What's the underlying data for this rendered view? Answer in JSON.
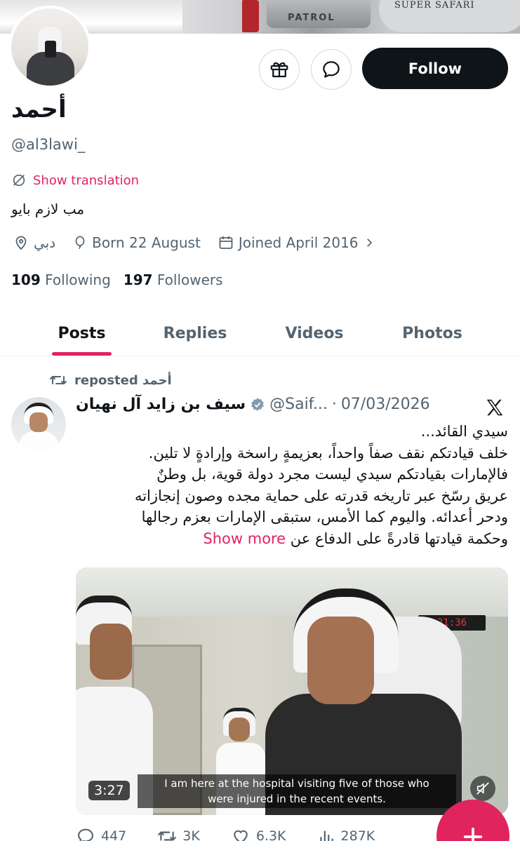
{
  "banner": {
    "plate_text": "PATROL",
    "tire_text": "SUPER SAFARI"
  },
  "profile": {
    "name": "أحمد",
    "handle": "@al3lawi_",
    "translate_label": "Show translation",
    "bio": "مب لازم بايو",
    "location": "دبي",
    "birthday": "Born 22 August",
    "joined": "Joined April 2016",
    "following_count": "109",
    "following_label": "Following",
    "followers_count": "197",
    "followers_label": "Followers",
    "follow_label": "Follow"
  },
  "tabs": [
    {
      "label": "Posts"
    },
    {
      "label": "Replies"
    },
    {
      "label": "Videos"
    },
    {
      "label": "Photos"
    }
  ],
  "post": {
    "repost_label": "reposted أحمد",
    "author_name": "سيف بن زايد آل نهيان",
    "author_handle": "@Saif...",
    "separator": "·",
    "date": "07/03/2026",
    "text_lines": [
      "سيدي القائد...",
      "خلف قيادتكم نقف صفاً واحداً، بعزيمةٍ راسخة وإرادةٍ لا تلين.",
      "فالإمارات بقيادتكم سيدي ليست مجرد دولة قوية، بل وطنٌ",
      "عريق رسّخ عبر تاريخه قدرته على حماية مجده وصون إنجازاته",
      "ودحر أعدائه. واليوم كما الأمس، ستبقى الإمارات بعزم رجالها",
      "وحكمة قيادتها قادرةً على الدفاع عن"
    ],
    "show_more": "Show more",
    "video": {
      "duration": "3:27",
      "caption_line1": "I am here at the hospital visiting five of those who",
      "caption_line2": "were injured in the recent events.",
      "clock": "21:36"
    },
    "actions": {
      "replies": "447",
      "reposts": "3K",
      "likes": "6.3K",
      "views": "287K"
    }
  },
  "colors": {
    "accent": "#e0245e",
    "text": "#0f1419",
    "muted": "#536471",
    "border": "#cfd9de"
  },
  "icons": [
    "gift-icon",
    "message-icon",
    "translate-icon",
    "location-icon",
    "balloon-icon",
    "calendar-icon",
    "chevron-right-icon",
    "repost-icon",
    "verified-icon",
    "x-logo-icon",
    "mute-icon",
    "reply-icon",
    "like-icon",
    "views-icon",
    "plus-icon"
  ]
}
